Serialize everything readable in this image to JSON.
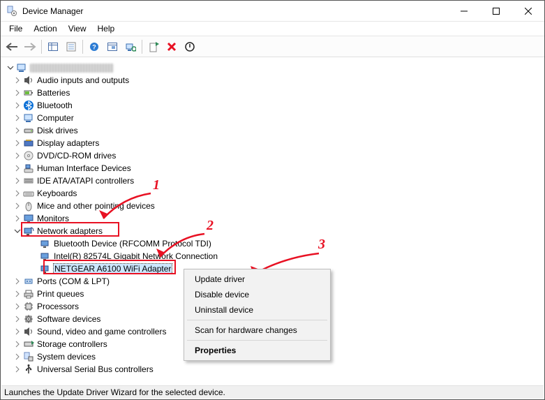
{
  "window": {
    "title": "Device Manager"
  },
  "menubar": {
    "file": "File",
    "action": "Action",
    "view": "View",
    "help": "Help"
  },
  "tree": {
    "root_name": "(computer name)",
    "categories": [
      {
        "label": "Audio inputs and outputs",
        "expanded": false
      },
      {
        "label": "Batteries",
        "expanded": false
      },
      {
        "label": "Bluetooth",
        "expanded": false
      },
      {
        "label": "Computer",
        "expanded": false
      },
      {
        "label": "Disk drives",
        "expanded": false
      },
      {
        "label": "Display adapters",
        "expanded": false
      },
      {
        "label": "DVD/CD-ROM drives",
        "expanded": false
      },
      {
        "label": "Human Interface Devices",
        "expanded": false
      },
      {
        "label": "IDE ATA/ATAPI controllers",
        "expanded": false
      },
      {
        "label": "Keyboards",
        "expanded": false
      },
      {
        "label": "Mice and other pointing devices",
        "expanded": false
      },
      {
        "label": "Monitors",
        "expanded": false
      },
      {
        "label": "Network adapters",
        "expanded": true,
        "children": [
          {
            "label": "Bluetooth Device (RFCOMM Protocol TDI)"
          },
          {
            "label": "Intel(R) 82574L Gigabit Network Connection"
          },
          {
            "label": "NETGEAR A6100 WiFi Adapter",
            "selected": true
          }
        ]
      },
      {
        "label": "Ports (COM & LPT)",
        "expanded": false
      },
      {
        "label": "Print queues",
        "expanded": false
      },
      {
        "label": "Processors",
        "expanded": false
      },
      {
        "label": "Software devices",
        "expanded": false
      },
      {
        "label": "Sound, video and game controllers",
        "expanded": false
      },
      {
        "label": "Storage controllers",
        "expanded": false
      },
      {
        "label": "System devices",
        "expanded": false
      },
      {
        "label": "Universal Serial Bus controllers",
        "expanded": false
      }
    ]
  },
  "context_menu": {
    "update_driver": "Update driver",
    "disable_device": "Disable device",
    "uninstall_device": "Uninstall device",
    "scan": "Scan for hardware changes",
    "properties": "Properties"
  },
  "statusbar": {
    "text": "Launches the Update Driver Wizard for the selected device."
  },
  "annotations": {
    "n1": "1",
    "n2": "2",
    "n3": "3"
  }
}
